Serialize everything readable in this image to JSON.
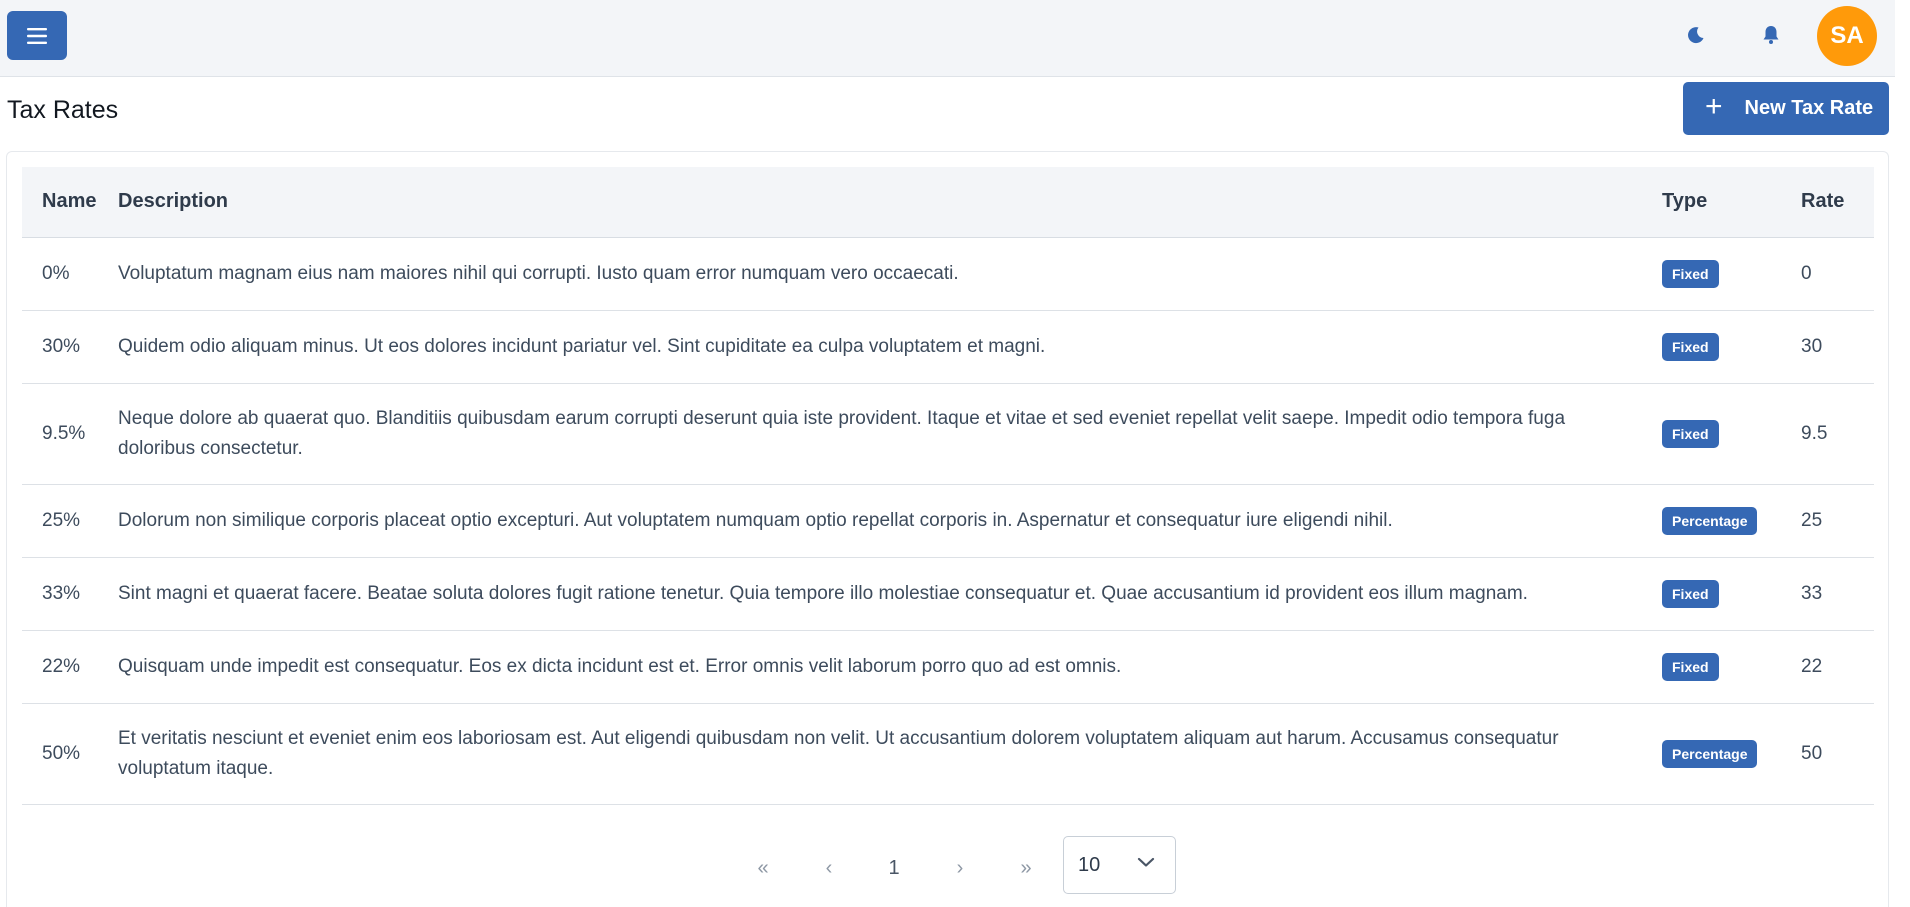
{
  "header": {
    "menu_icon": "hamburger-icon",
    "theme_icon": "moon-icon",
    "notification_icon": "bell-icon",
    "avatar_initials": "SA",
    "avatar_color": "#ff9a0a",
    "accent_color": "#3568b4"
  },
  "page": {
    "title": "Tax Rates",
    "new_button_label": "New Tax Rate",
    "new_button_icon": "plus-icon"
  },
  "table": {
    "columns": [
      "Name",
      "Description",
      "Type",
      "Rate"
    ],
    "rows": [
      {
        "name": "0%",
        "description": "Voluptatum magnam eius nam maiores nihil qui corrupti. Iusto quam error numquam vero occaecati.",
        "type": "Fixed",
        "rate": "0"
      },
      {
        "name": "30%",
        "description": "Quidem odio aliquam minus. Ut eos dolores incidunt pariatur vel. Sint cupiditate ea culpa voluptatem et magni.",
        "type": "Fixed",
        "rate": "30"
      },
      {
        "name": "9.5%",
        "description": "Neque dolore ab quaerat quo. Blanditiis quibusdam earum corrupti deserunt quia iste provident. Itaque et vitae et sed eveniet repellat velit saepe. Impedit odio tempora fuga doloribus consectetur.",
        "type": "Fixed",
        "rate": "9.5"
      },
      {
        "name": "25%",
        "description": "Dolorum non similique corporis placeat optio excepturi. Aut voluptatem numquam optio repellat corporis in. Aspernatur et consequatur iure eligendi nihil.",
        "type": "Percentage",
        "rate": "25"
      },
      {
        "name": "33%",
        "description": "Sint magni et quaerat facere. Beatae soluta dolores fugit ratione tenetur. Quia tempore illo molestiae consequatur et. Quae accusantium id provident eos illum magnam.",
        "type": "Fixed",
        "rate": "33"
      },
      {
        "name": "22%",
        "description": "Quisquam unde impedit est consequatur. Eos ex dicta incidunt est et. Error omnis velit laborum porro quo ad est omnis.",
        "type": "Fixed",
        "rate": "22"
      },
      {
        "name": "50%",
        "description": "Et veritatis nesciunt et eveniet enim eos laboriosam est. Aut eligendi quibusdam non velit. Ut accusantium dolorem voluptatem aliquam aut harum. Accusamus consequatur voluptatum itaque.",
        "type": "Percentage",
        "rate": "50"
      }
    ]
  },
  "pagination": {
    "first": "«",
    "prev": "‹",
    "current_page": "1",
    "next": "›",
    "last": "»",
    "page_size": "10",
    "page_size_icon": "chevron-down-icon"
  }
}
